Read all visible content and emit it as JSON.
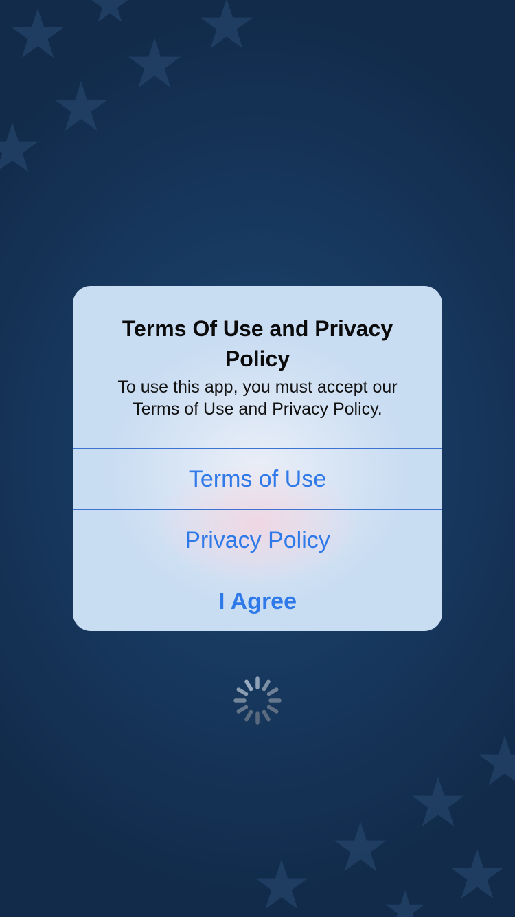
{
  "alert": {
    "title": "Terms Of Use and Privacy Policy",
    "message": "To use this app, you must accept our Terms of Use and Privacy Policy.",
    "buttons": {
      "terms": "Terms of Use",
      "privacy": "Privacy Policy",
      "agree": "I Agree"
    }
  },
  "colors": {
    "background": "#183a61",
    "alert_background": "#c8dcf2",
    "button_text": "#2f7ae8",
    "separator": "#3e74d0"
  },
  "icons": {
    "background_decoration": "star-pattern",
    "loading": "activity-indicator"
  }
}
